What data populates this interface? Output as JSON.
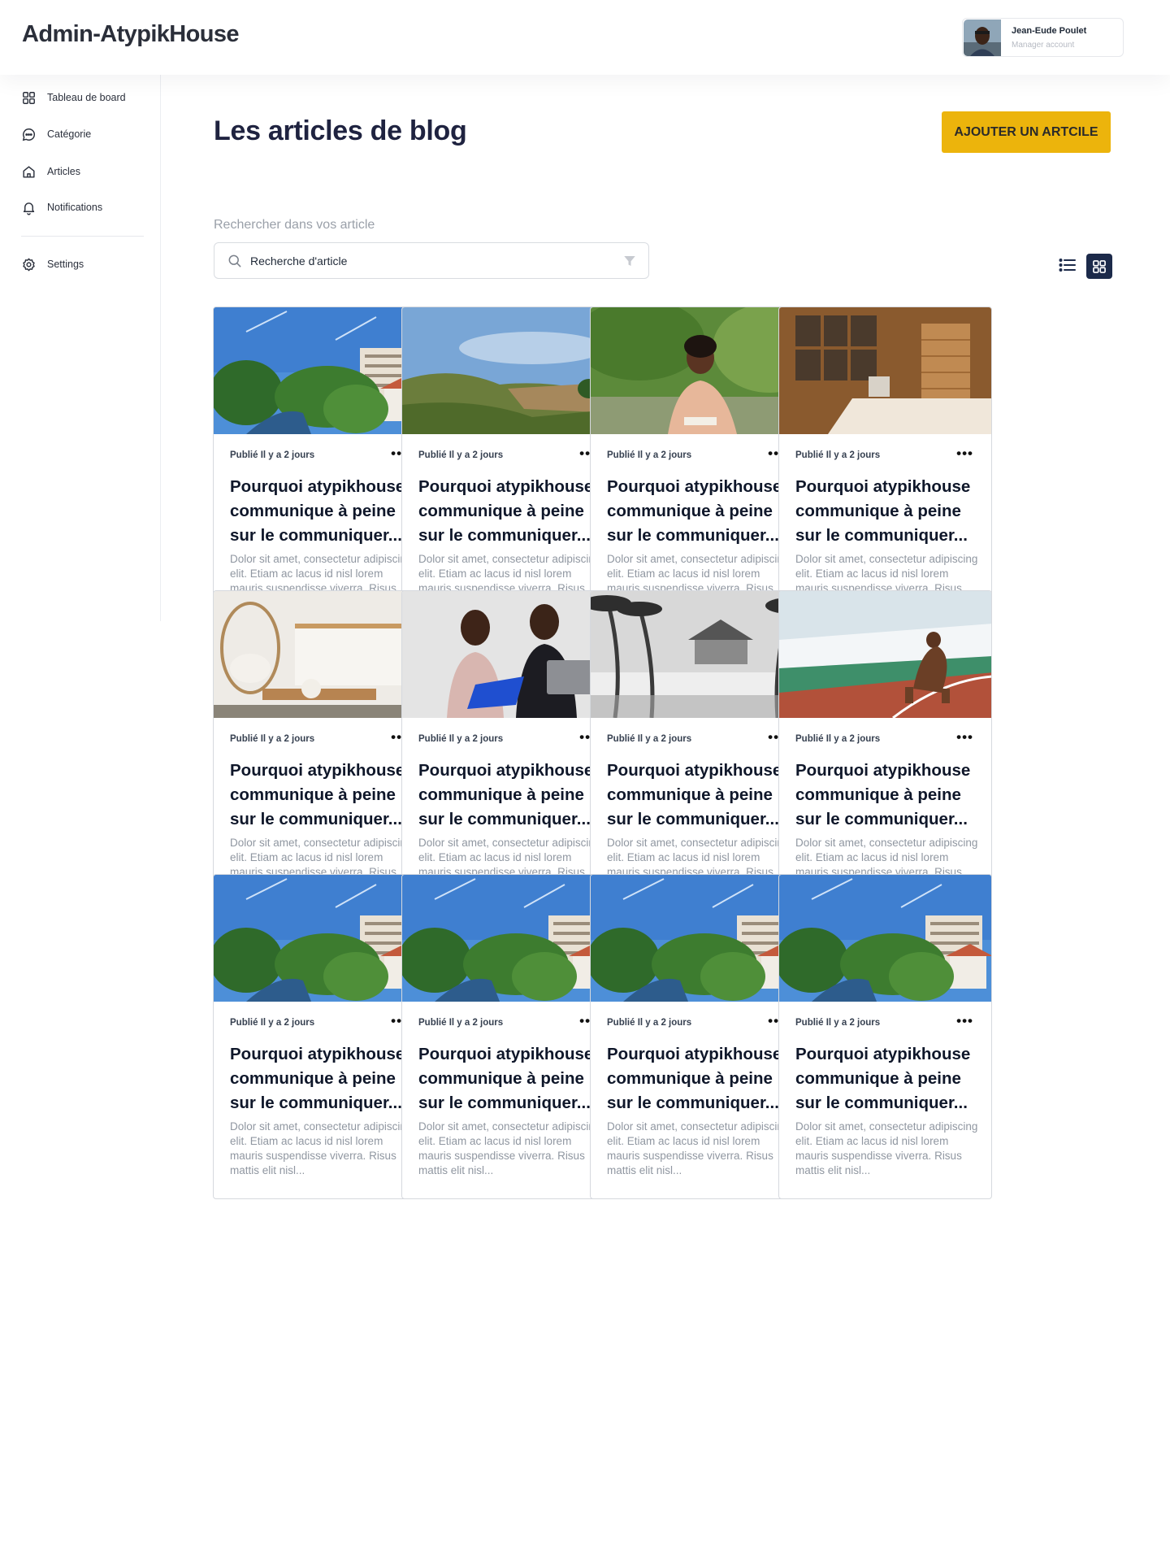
{
  "app": {
    "brand": "Admin-AtypikHouse"
  },
  "user": {
    "name": "Jean-Eude Poulet",
    "role": "Manager account"
  },
  "sidebar": {
    "items": [
      {
        "label": "Tableau de board",
        "icon": "dashboard-icon"
      },
      {
        "label": "Catégorie",
        "icon": "chat-icon"
      },
      {
        "label": "Articles",
        "icon": "home-icon"
      },
      {
        "label": "Notifications",
        "icon": "bell-icon"
      },
      {
        "label": "Settings",
        "icon": "gear-icon"
      }
    ]
  },
  "main": {
    "title": "Les articles de blog",
    "add_button": "AJOUTER UN ARTCILE",
    "search_label": "Rechercher dans vos article",
    "search_placeholder": "Recherche d'article"
  },
  "colors": {
    "accent": "#ECB40C",
    "navy": "#1C2A4A"
  },
  "articles": [
    {
      "meta": "Publié Il y a 2 jours",
      "title": "Pourquoi atypikhouse communique à peine sur le communiquer...",
      "excerpt": "Dolor sit amet, consectetur adipiscing elit. Etiam ac lacus id nisl lorem mauris suspendisse viverra. Risus mattis elit nisl...",
      "image": "river-town"
    },
    {
      "meta": "Publié Il y a 2 jours",
      "title": "Pourquoi atypikhouse communique à peine sur le communiquer...",
      "excerpt": "Dolor sit amet, consectetur adipiscing elit. Etiam ac lacus id nisl lorem mauris suspendisse viverra. Risus mattis elit nisl...",
      "image": "hills-landscape"
    },
    {
      "meta": "Publié Il y a 2 jours",
      "title": "Pourquoi atypikhouse communique à peine sur le communiquer...",
      "excerpt": "Dolor sit amet, consectetur adipiscing elit. Etiam ac lacus id nisl lorem mauris suspendisse viverra. Risus mattis elit nisl...",
      "image": "woman-park"
    },
    {
      "meta": "Publié Il y a 2 jours",
      "title": "Pourquoi atypikhouse communique à peine sur le communiquer...",
      "excerpt": "Dolor sit amet, consectetur adipiscing elit. Etiam ac lacus id nisl lorem mauris suspendisse viverra. Risus mattis elit nisl...",
      "image": "wooden-bedroom"
    },
    {
      "meta": "Publié Il y a 2 jours",
      "title": "Pourquoi atypikhouse communique à peine sur le communiquer...",
      "excerpt": "Dolor sit amet, consectetur adipiscing elit. Etiam ac lacus id nisl lorem mauris suspendisse viverra. Risus mattis elit nisl...",
      "image": "kitchen-interior"
    },
    {
      "meta": "Publié Il y a 2 jours",
      "title": "Pourquoi atypikhouse communique à peine sur le communiquer...",
      "excerpt": "Dolor sit amet, consectetur adipiscing elit. Etiam ac lacus id nisl lorem mauris suspendisse viverra. Risus mattis elit nisl...",
      "image": "couple-laptop"
    },
    {
      "meta": "Publié Il y a 2 jours",
      "title": "Pourquoi atypikhouse communique à peine sur le communiquer...",
      "excerpt": "Dolor sit amet, consectetur adipiscing elit. Etiam ac lacus id nisl lorem mauris suspendisse viverra. Risus mattis elit nisl...",
      "image": "beach-huts"
    },
    {
      "meta": "Publié Il y a 2 jours",
      "title": "Pourquoi atypikhouse communique à peine sur le communiquer...",
      "excerpt": "Dolor sit amet, consectetur adipiscing elit. Etiam ac lacus id nisl lorem mauris suspendisse viverra. Risus mattis elit nisl...",
      "image": "sprinter-track"
    },
    {
      "meta": "Publié Il y a 2 jours",
      "title": "Pourquoi atypikhouse communique à peine sur le communiquer...",
      "excerpt": "Dolor sit amet, consectetur adipiscing elit. Etiam ac lacus id nisl lorem mauris suspendisse viverra. Risus mattis elit nisl...",
      "image": "river-town"
    },
    {
      "meta": "Publié Il y a 2 jours",
      "title": "Pourquoi atypikhouse communique à peine sur le communiquer...",
      "excerpt": "Dolor sit amet, consectetur adipiscing elit. Etiam ac lacus id nisl lorem mauris suspendisse viverra. Risus mattis elit nisl...",
      "image": "river-town"
    },
    {
      "meta": "Publié Il y a 2 jours",
      "title": "Pourquoi atypikhouse communique à peine sur le communiquer...",
      "excerpt": "Dolor sit amet, consectetur adipiscing elit. Etiam ac lacus id nisl lorem mauris suspendisse viverra. Risus mattis elit nisl...",
      "image": "river-town"
    },
    {
      "meta": "Publié Il y a 2 jours",
      "title": "Pourquoi atypikhouse communique à peine sur le communiquer...",
      "excerpt": "Dolor sit amet, consectetur adipiscing elit. Etiam ac lacus id nisl lorem mauris suspendisse viverra. Risus mattis elit nisl...",
      "image": "river-town"
    }
  ]
}
